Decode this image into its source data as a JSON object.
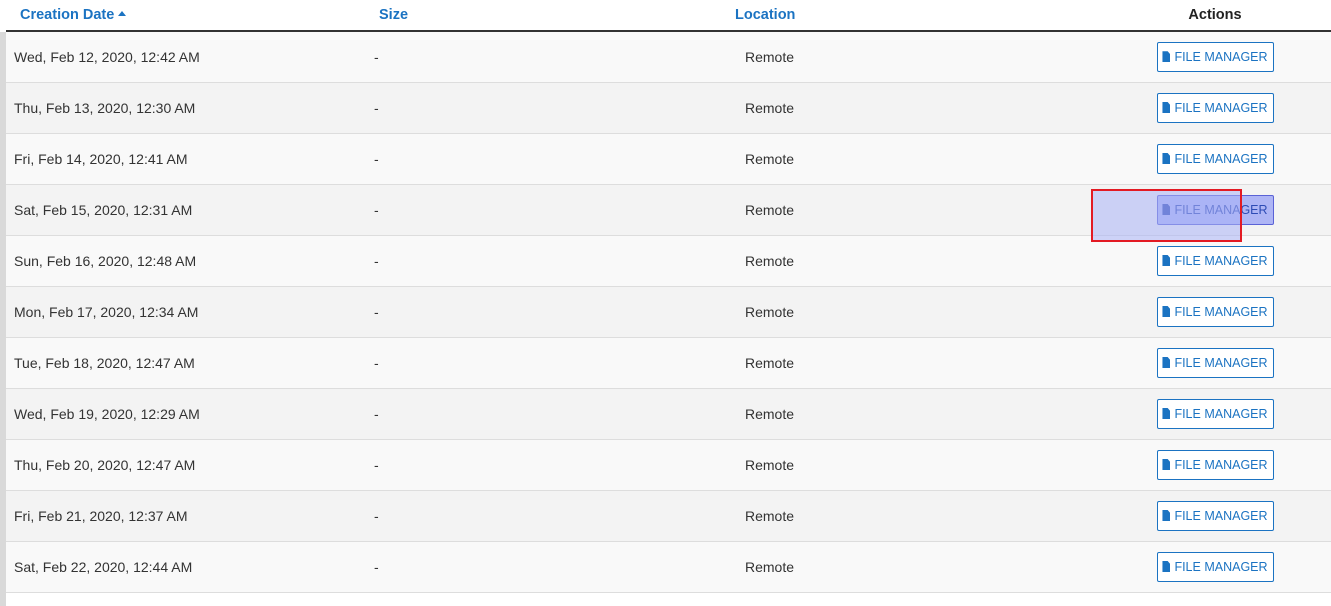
{
  "table": {
    "headers": {
      "creation_date": "Creation Date",
      "size": "Size",
      "location": "Location",
      "actions": "Actions"
    },
    "sort": {
      "column": "creation_date",
      "direction": "ascending"
    },
    "action_label": "FILE MANAGER",
    "rows": [
      {
        "date": "Wed, Feb 12, 2020, 12:42 AM",
        "size": "-",
        "location": "Remote"
      },
      {
        "date": "Thu, Feb 13, 2020, 12:30 AM",
        "size": "-",
        "location": "Remote"
      },
      {
        "date": "Fri, Feb 14, 2020, 12:41 AM",
        "size": "-",
        "location": "Remote"
      },
      {
        "date": "Sat, Feb 15, 2020, 12:31 AM",
        "size": "-",
        "location": "Remote"
      },
      {
        "date": "Sun, Feb 16, 2020, 12:48 AM",
        "size": "-",
        "location": "Remote"
      },
      {
        "date": "Mon, Feb 17, 2020, 12:34 AM",
        "size": "-",
        "location": "Remote"
      },
      {
        "date": "Tue, Feb 18, 2020, 12:47 AM",
        "size": "-",
        "location": "Remote"
      },
      {
        "date": "Wed, Feb 19, 2020, 12:29 AM",
        "size": "-",
        "location": "Remote"
      },
      {
        "date": "Thu, Feb 20, 2020, 12:47 AM",
        "size": "-",
        "location": "Remote"
      },
      {
        "date": "Fri, Feb 21, 2020, 12:37 AM",
        "size": "-",
        "location": "Remote"
      },
      {
        "date": "Sat, Feb 22, 2020, 12:44 AM",
        "size": "-",
        "location": "Remote"
      }
    ]
  },
  "colors": {
    "link_blue": "#1b73c2",
    "highlight_border": "#e31a23",
    "highlight_fill": "#aeb5f5"
  },
  "icons": {
    "sort": "caret-up-icon",
    "action": "file-icon"
  }
}
